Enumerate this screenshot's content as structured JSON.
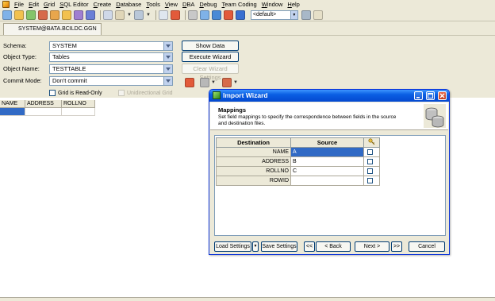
{
  "menu": [
    "File",
    "Edit",
    "Grid",
    "SQL Editor",
    "Create",
    "Database",
    "Tools",
    "View",
    "DBA",
    "Debug",
    "Team Coding",
    "Window",
    "Help"
  ],
  "toolbar": {
    "combo_value": "<default>"
  },
  "connection_tab": "SYSTEM@BATA.BCILDC.GGN",
  "form": {
    "schema_label": "Schema:",
    "schema_value": "SYSTEM",
    "object_type_label": "Object Type:",
    "object_type_value": "Tables",
    "object_name_label": "Object Name:",
    "object_name_value": "TESTTABLE",
    "commit_mode_label": "Commit Mode:",
    "commit_mode_value": "Don't commit",
    "show_data": "Show Data",
    "execute_wizard": "Execute Wizard",
    "clear_wizard": "Clear Wizard Settings",
    "grid_read_only": "Grid is Read-Only",
    "unidirectional_grid": "Unidirectional Grid"
  },
  "grid": {
    "columns": [
      "NAME",
      "ADDRESS",
      "ROLLNO"
    ]
  },
  "dialog": {
    "title": "Import Wizard",
    "header_title": "Mappings",
    "header_desc": "Set field mappings to specify the correspondence between fields in the source and destination files.",
    "table": {
      "destination_header": "Destination",
      "source_header": "Source",
      "rows": [
        {
          "destination": "NAME",
          "source": "A",
          "active": true
        },
        {
          "destination": "ADDRESS",
          "source": "B",
          "active": false
        },
        {
          "destination": "ROLLNO",
          "source": "C",
          "active": false
        },
        {
          "destination": "ROWID",
          "source": "",
          "active": false
        }
      ]
    },
    "buttons": {
      "load": "Load Settings",
      "save": "Save Settings",
      "first": "<<",
      "back": "< Back",
      "next": "Next >",
      "last": ">>",
      "cancel": "Cancel"
    }
  }
}
